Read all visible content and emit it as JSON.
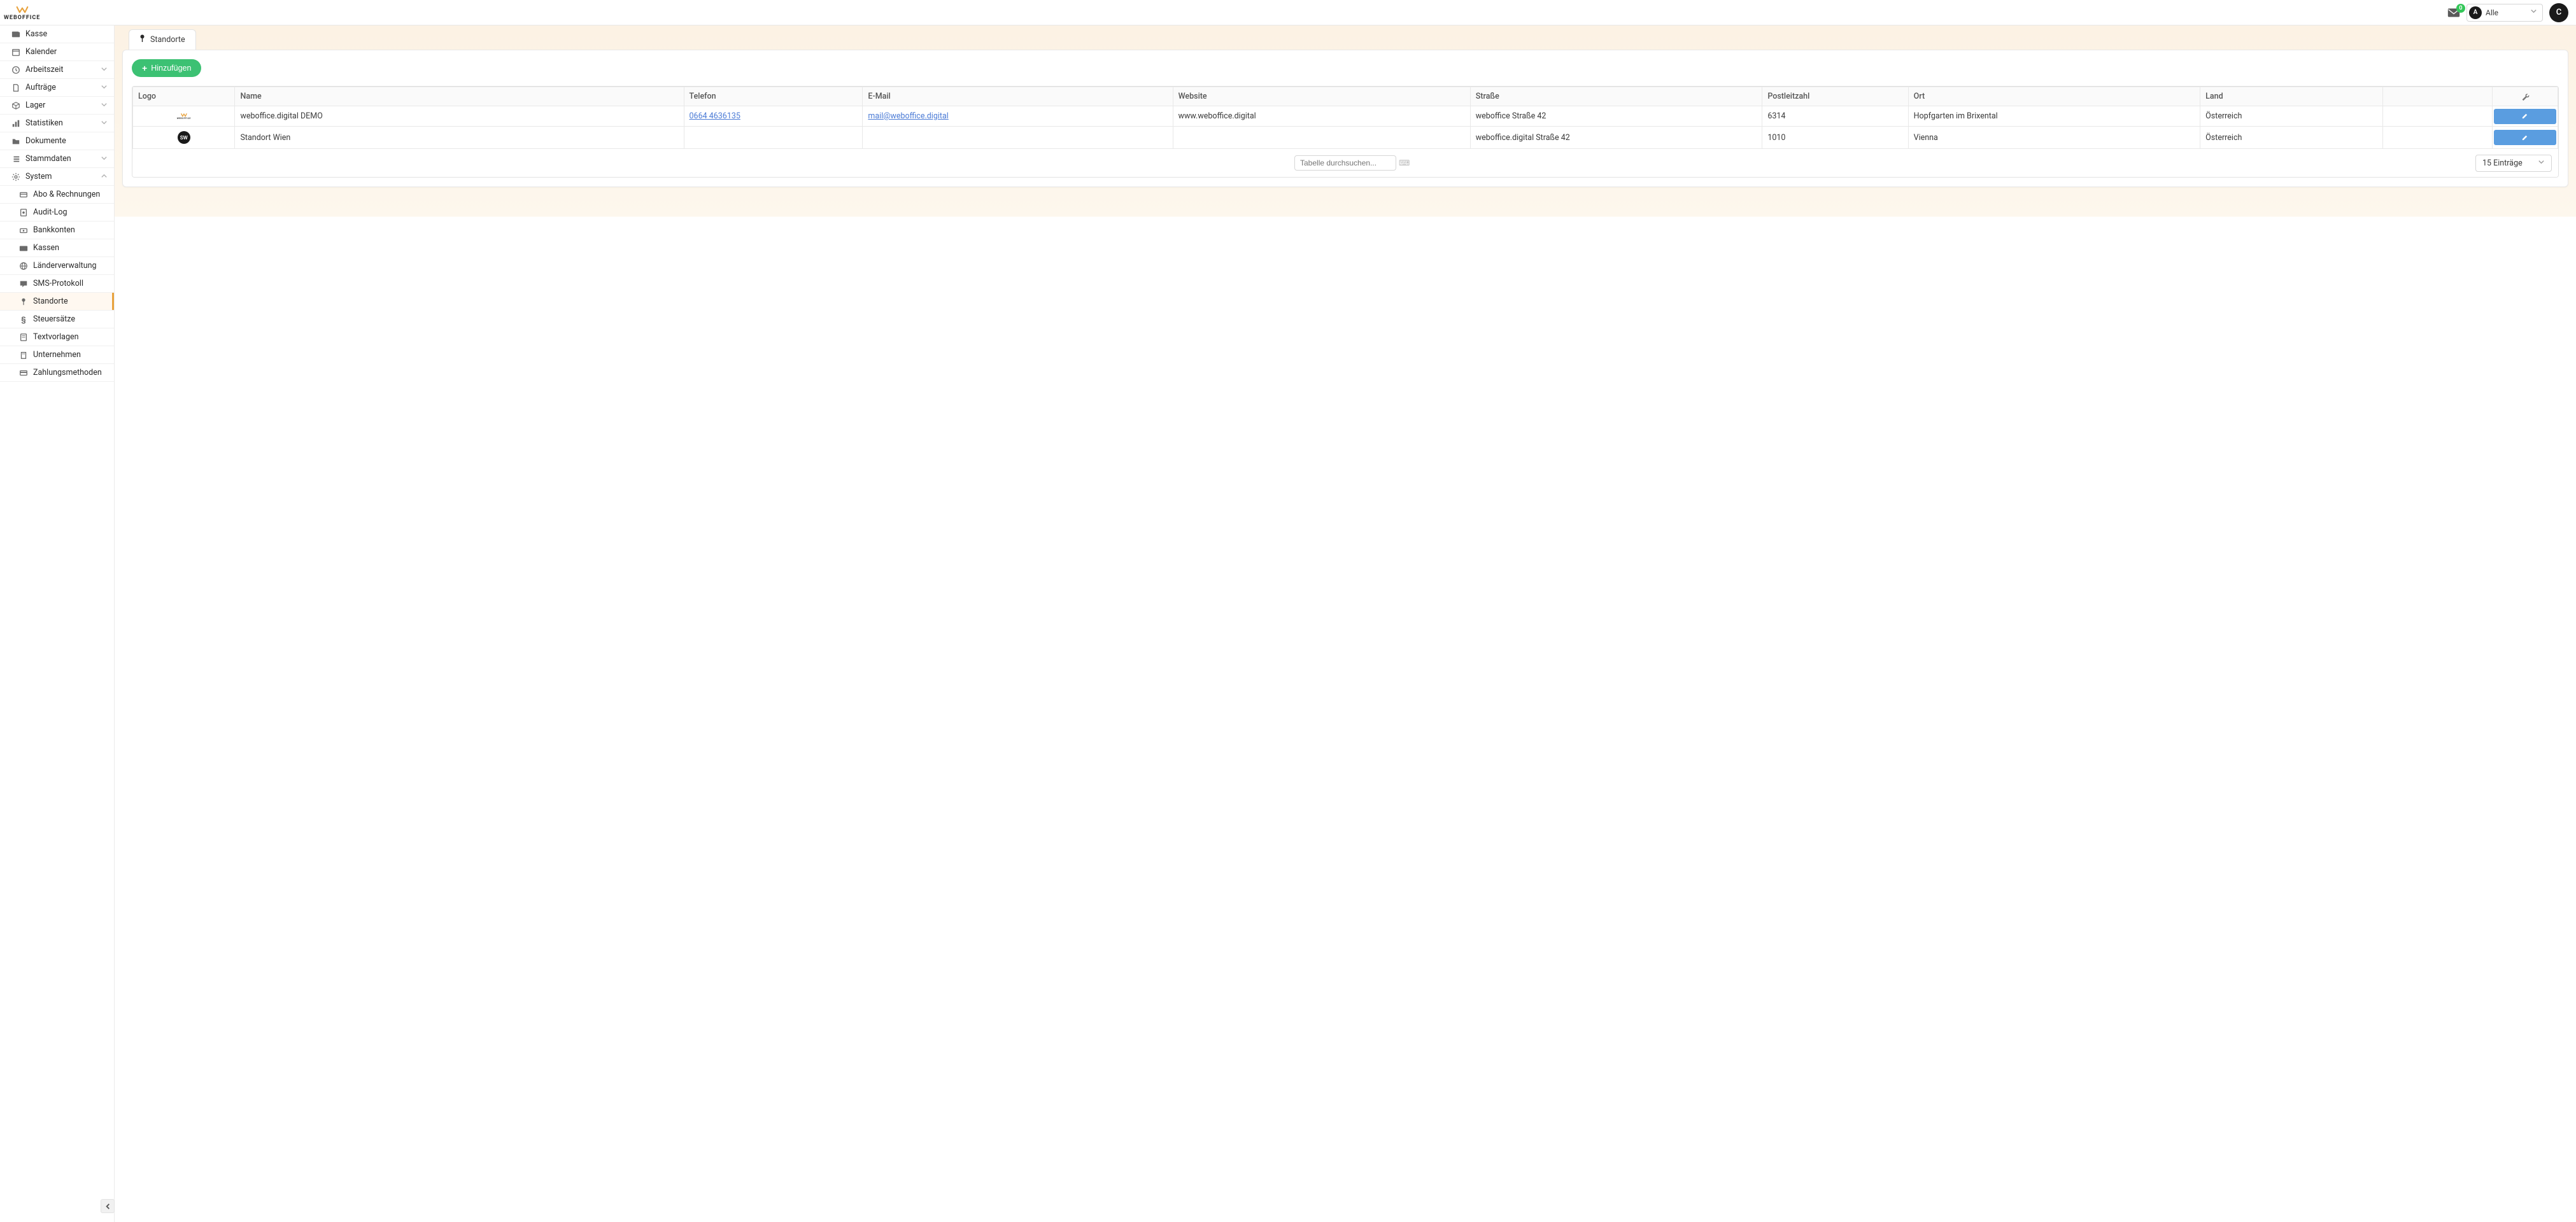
{
  "brand": "WEBOFFICE",
  "header": {
    "notifications": "0",
    "filter_badge": "A",
    "filter_label": "Alle",
    "user_initial": "C"
  },
  "sidebar": {
    "items": [
      {
        "key": "kasse",
        "label": "Kasse",
        "icon": "wallet"
      },
      {
        "key": "kalender",
        "label": "Kalender",
        "icon": "calendar"
      },
      {
        "key": "arbeitszeit",
        "label": "Arbeitszeit",
        "icon": "clock",
        "expandable": true
      },
      {
        "key": "auftraege",
        "label": "Aufträge",
        "icon": "file",
        "expandable": true
      },
      {
        "key": "lager",
        "label": "Lager",
        "icon": "box",
        "expandable": true
      },
      {
        "key": "statistiken",
        "label": "Statistiken",
        "icon": "chart",
        "expandable": true
      },
      {
        "key": "dokumente",
        "label": "Dokumente",
        "icon": "folder"
      },
      {
        "key": "stammdaten",
        "label": "Stammdaten",
        "icon": "list",
        "expandable": true
      },
      {
        "key": "system",
        "label": "System",
        "icon": "gear",
        "expanded": true
      }
    ],
    "system_children": [
      {
        "key": "abo",
        "label": "Abo & Rechnungen",
        "icon": "card"
      },
      {
        "key": "audit",
        "label": "Audit-Log",
        "icon": "log"
      },
      {
        "key": "bank",
        "label": "Bankkonten",
        "icon": "bank"
      },
      {
        "key": "kassen",
        "label": "Kassen",
        "icon": "wallet"
      },
      {
        "key": "laender",
        "label": "Länderverwaltung",
        "icon": "globe"
      },
      {
        "key": "sms",
        "label": "SMS-Protokoll",
        "icon": "chat"
      },
      {
        "key": "standorte",
        "label": "Standorte",
        "icon": "pin",
        "active": true
      },
      {
        "key": "steuer",
        "label": "Steuersätze",
        "icon": "para"
      },
      {
        "key": "text",
        "label": "Textvorlagen",
        "icon": "doc"
      },
      {
        "key": "unternehmen",
        "label": "Unternehmen",
        "icon": "building"
      },
      {
        "key": "zahlung",
        "label": "Zahlungsmethoden",
        "icon": "credit"
      }
    ]
  },
  "tabs": {
    "current": "Standorte"
  },
  "toolbar": {
    "add_label": "Hinzufügen"
  },
  "table": {
    "columns": {
      "logo": "Logo",
      "name": "Name",
      "telefon": "Telefon",
      "email": "E-Mail",
      "website": "Website",
      "strasse": "Straße",
      "plz": "Postleitzahl",
      "ort": "Ort",
      "land": "Land"
    },
    "rows": [
      {
        "logo": "weboffice",
        "name": "weboffice.digital DEMO",
        "telefon": "0664 4636135",
        "email": "mail@weboffice.digital",
        "website": "www.weboffice.digital",
        "strasse": "weboffice Straße 42",
        "plz": "6314",
        "ort": "Hopfgarten im Brixental",
        "land": "Österreich"
      },
      {
        "logo": "SW",
        "name": "Standort Wien",
        "telefon": "",
        "email": "",
        "website": "",
        "strasse": "weboffice.digital Straße 42",
        "plz": "1010",
        "ort": "Vienna",
        "land": "Österreich"
      }
    ],
    "search_placeholder": "Tabelle durchsuchen...",
    "entries_label": "15 Einträge"
  }
}
